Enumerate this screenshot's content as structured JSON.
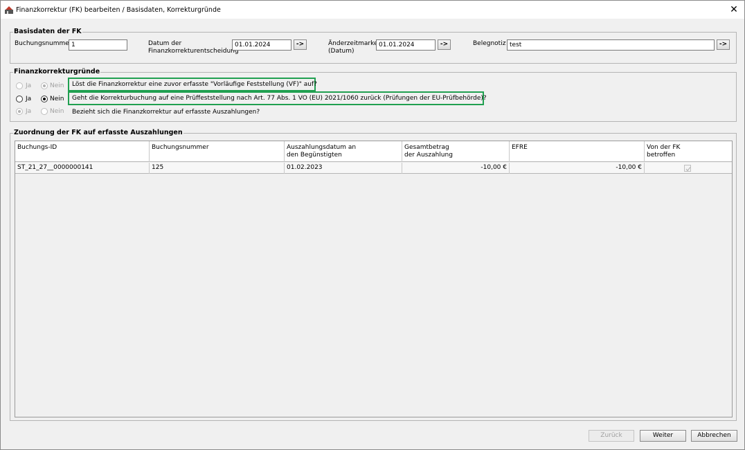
{
  "window": {
    "title": "Finanzkorrektur (FK) bearbeiten / Basisdaten, Korrekturgründe",
    "close_symbol": "✕"
  },
  "basisdaten": {
    "title": "Basisdaten der FK",
    "buchungsnummer_label": "Buchungsnummer",
    "buchungsnummer_value": "1",
    "datum_label_1": "Datum der",
    "datum_label_2": "Finanzkorrekturentscheidung",
    "datum_value": "01.01.2024",
    "aenderung_label_1": "Änderzeitmarke",
    "aenderung_label_2": "(Datum)",
    "aenderung_value": "01.01.2024",
    "belegnotiz_label": "Belegnotiz",
    "belegnotiz_value": "test",
    "arrow_label": "->"
  },
  "korrekturgruende": {
    "title": "Finanzkorrekturgründe",
    "ja_label": "Ja",
    "nein_label": "Nein",
    "questions": [
      "Löst die Finanzkorrektur eine zuvor erfasste \"Vorläufige Feststellung (VF)\" auf?",
      "Geht die Korrekturbuchung auf eine Prüffeststellung nach Art. 77 Abs. 1 VO (EU) 2021/1060 zurück (Prüfungen der EU-Prüfbehörde)?",
      "Bezieht sich die Finanzkorrektur auf erfasste Auszahlungen?"
    ]
  },
  "zuordnung": {
    "title": "Zuordnung der FK auf erfasste Auszahlungen",
    "columns": [
      [
        "Buchungs-ID",
        ""
      ],
      [
        "Buchungsnummer",
        ""
      ],
      [
        "Auszahlungsdatum an",
        "den Begünstigten"
      ],
      [
        "Gesamtbetrag",
        "der Auszahlung"
      ],
      [
        "EFRE",
        ""
      ],
      [
        "Von der FK",
        "betroffen"
      ]
    ],
    "rows": [
      {
        "buchungs_id": "ST_21_27__0000000141",
        "buchungsnummer": "125",
        "datum": "01.02.2023",
        "gesamtbetrag": "-10,00 €",
        "efre": "-10,00 €",
        "betroffen": true
      }
    ]
  },
  "buttons": {
    "zurueck": "Zurück",
    "weiter": "Weiter",
    "abbrechen": "Abbrechen"
  },
  "colors": {
    "highlight_border": "#20a050"
  }
}
